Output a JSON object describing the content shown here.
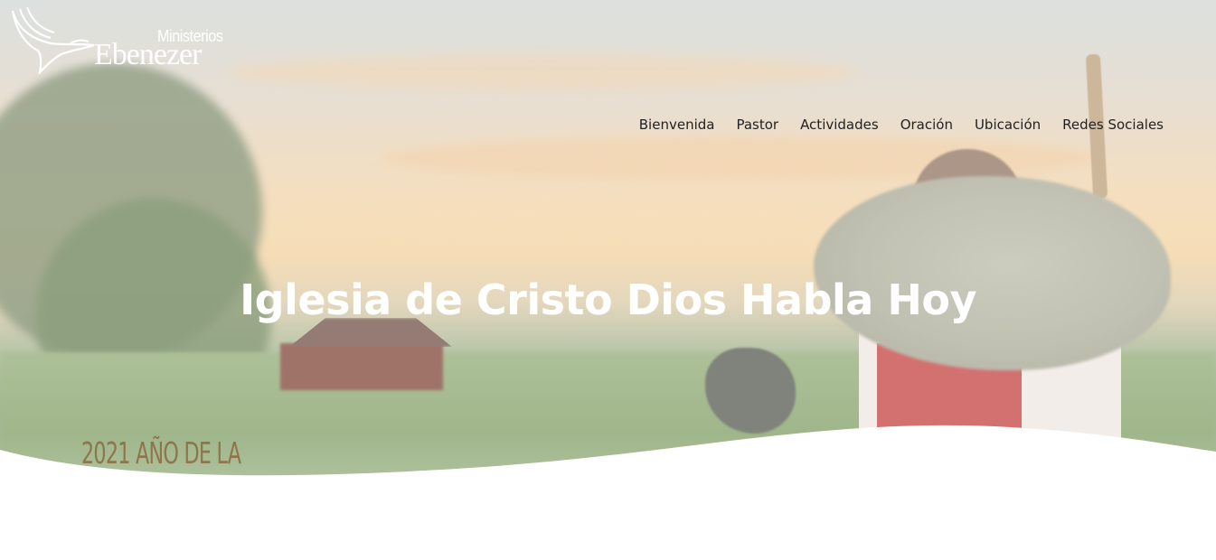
{
  "brand": {
    "line1": "Ministerios",
    "line2": "Ebenezer"
  },
  "nav": {
    "items": [
      "Bienvenida",
      "Pastor",
      "Actividades",
      "Oración",
      "Ubicación",
      "Redes Sociales"
    ]
  },
  "hero": {
    "title": "Iglesia de Cristo Dios Habla Hoy",
    "caption": "2021 AÑO DE LA"
  },
  "colors": {
    "nav_text": "#222222",
    "title_text": "#ffffff",
    "background": "#ffffff"
  }
}
